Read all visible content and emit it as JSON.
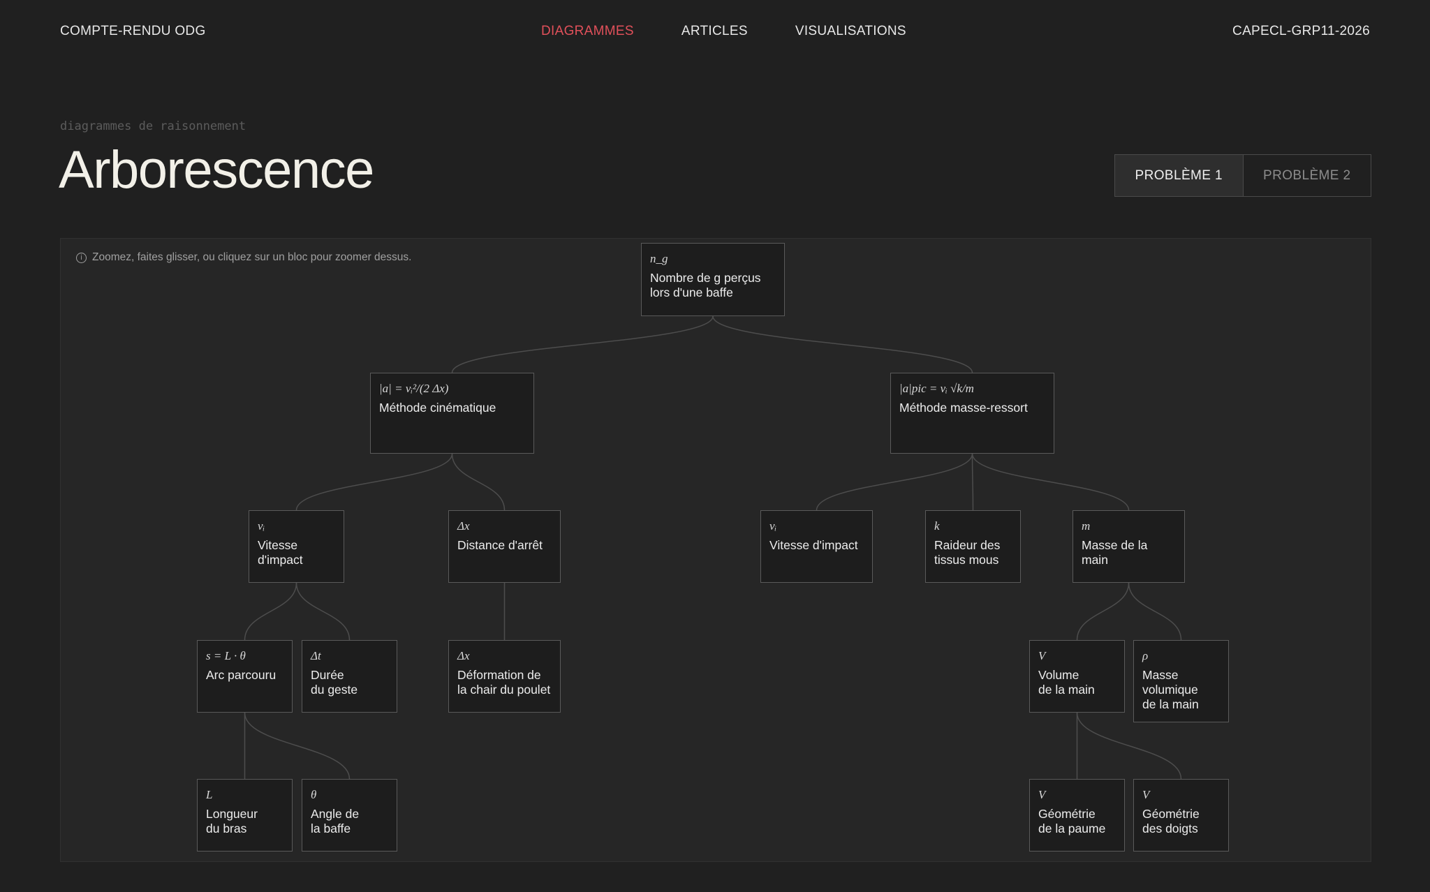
{
  "nav": {
    "brand": "COMPTE-RENDU ODG",
    "items": [
      "DIAGRAMMES",
      "ARTICLES",
      "VISUALISATIONS"
    ],
    "active": "DIAGRAMMES",
    "code": "CAPECL-GRP11-2026",
    "accent_color": "#e0505a"
  },
  "header": {
    "eyebrow": "diagrammes de raisonnement",
    "title": "Arborescence"
  },
  "toggle": {
    "problem1": "PROBLÈME 1",
    "problem2": "PROBLÈME 2",
    "selected": "PROBLÈME 1"
  },
  "canvas": {
    "hint_icon": "info-icon",
    "hint": "Zoomez, faites glisser, ou cliquez sur un bloc pour zoomer dessus."
  },
  "tree": {
    "nodes": [
      {
        "id": "root",
        "formula": "n_g",
        "label": "Nombre de g perçus\nlors d'une baffe",
        "parent": null
      },
      {
        "id": "cin",
        "formula": "|a| = vᵢ²/(2 Δx)",
        "label": "Méthode cinématique",
        "parent": "root"
      },
      {
        "id": "mr",
        "formula": "|a|pic = vᵢ √k/m",
        "label": "Méthode masse-ressort",
        "parent": "root"
      },
      {
        "id": "vi1",
        "formula": "vᵢ",
        "label": "Vitesse\nd'impact",
        "parent": "cin"
      },
      {
        "id": "dx1",
        "formula": "Δx",
        "label": "Distance d'arrêt",
        "parent": "cin"
      },
      {
        "id": "vi2",
        "formula": "vᵢ",
        "label": "Vitesse d'impact",
        "parent": "mr"
      },
      {
        "id": "k",
        "formula": "k",
        "label": "Raideur des\ntissus mous",
        "parent": "mr"
      },
      {
        "id": "m",
        "formula": "m",
        "label": "Masse de la main",
        "parent": "mr"
      },
      {
        "id": "s",
        "formula": "s = L · θ",
        "label": "Arc parcouru",
        "parent": "vi1"
      },
      {
        "id": "dt",
        "formula": "Δt",
        "label": "Durée\ndu geste",
        "parent": "vi1"
      },
      {
        "id": "dx2",
        "formula": "Δx",
        "label": "Déformation de\nla chair du poulet",
        "parent": "dx1"
      },
      {
        "id": "V",
        "formula": "V",
        "label": "Volume\nde la main",
        "parent": "m"
      },
      {
        "id": "rho",
        "formula": "ρ",
        "label": "Masse\nvolumique\nde la main",
        "parent": "m"
      },
      {
        "id": "L",
        "formula": "L",
        "label": "Longueur\ndu bras",
        "parent": "s"
      },
      {
        "id": "theta",
        "formula": "θ",
        "label": "Angle de\nla baffe",
        "parent": "s"
      },
      {
        "id": "Vp",
        "formula": "V",
        "label": "Géométrie\nde la paume",
        "parent": "V"
      },
      {
        "id": "Vd",
        "formula": "V",
        "label": "Géométrie\ndes doigts",
        "parent": "V"
      }
    ]
  }
}
